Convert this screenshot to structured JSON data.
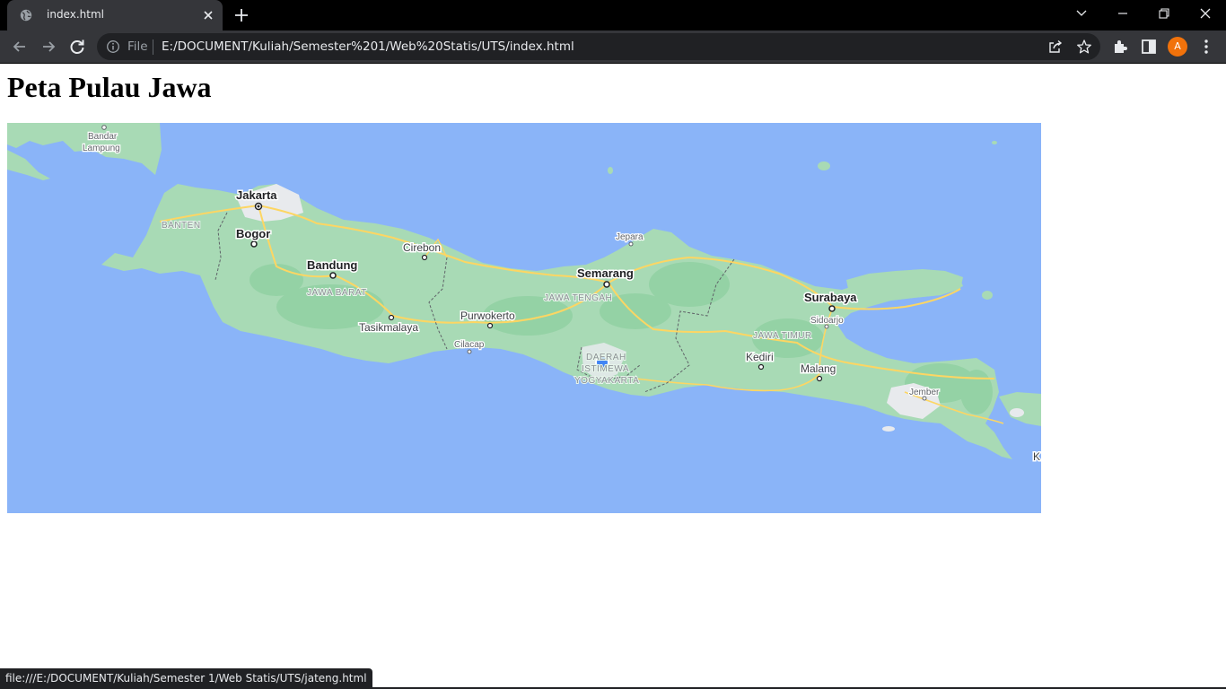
{
  "browser": {
    "tab_title": "index.html",
    "address_scheme": "File",
    "address_url": "E:/DOCUMENT/Kuliah/Semester%201/Web%20Statis/UTS/index.html",
    "profile_initial": "A",
    "status_url": "file:///E:/DOCUMENT/Kuliah/Semester 1/Web Statis/UTS/jateng.html"
  },
  "page": {
    "title": "Peta Pulau Jawa"
  },
  "map": {
    "cities": {
      "jakarta": "Jakarta",
      "bogor": "Bogor",
      "bandung": "Bandung",
      "cirebon": "Cirebon",
      "semarang": "Semarang",
      "surabaya": "Surabaya",
      "malang": "Malang",
      "kediri": "Kediri",
      "purwokerto": "Purwokerto",
      "tasikmalaya": "Tasikmalaya"
    },
    "towns": {
      "bandar_lampung_1": "Bandar",
      "bandar_lampung_2": "Lampung",
      "jepara": "Jepara",
      "cilacap": "Cilacap",
      "sidoarjo": "Sidoarjo",
      "jember": "Jember",
      "k_edge": "K"
    },
    "provinces": {
      "banten": "BANTEN",
      "jawa_barat": "JAWA BARAT",
      "jawa_tengah": "JAWA TENGAH",
      "jawa_timur": "JAWA TIMUR",
      "diy_1": "DAERAH",
      "diy_2": "ISTIMEWA",
      "diy_3": "YOGYAKARTA"
    },
    "colors": {
      "sea": "#8ab4f8",
      "land": "#a8dab5",
      "land_dark": "#94d2a5",
      "urban": "#e8eaed",
      "road": "#fdd663",
      "location_dot": "#4285f4"
    }
  }
}
